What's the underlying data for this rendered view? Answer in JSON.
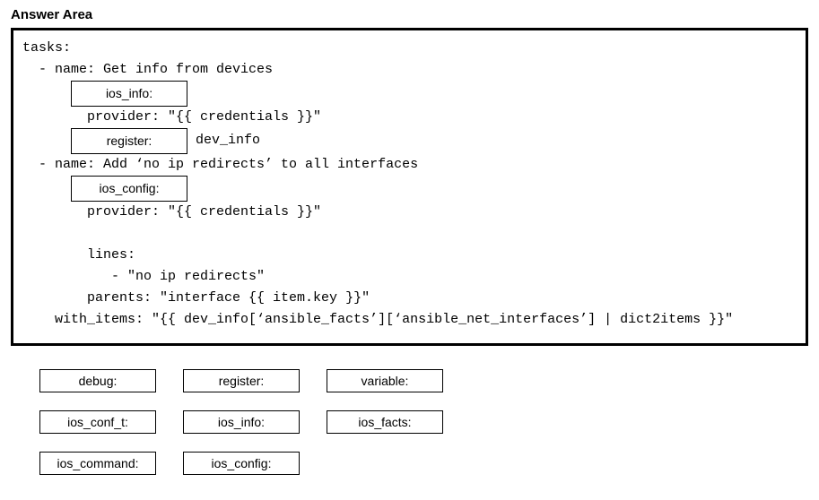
{
  "title": "Answer Area",
  "code": {
    "tasks_label": "tasks:",
    "task1_name": "  - name: Get info from devices",
    "slot1_value": "ios_info:",
    "provider1": "provider: \"{{ credentials }}\"",
    "slot2_value": "register:",
    "dev_info": " dev_info",
    "task2_name": "  - name: Add ‘no ip redirects’ to all interfaces",
    "slot3_value": "ios_config:",
    "provider2": "provider: \"{{ credentials }}\"",
    "lines_label": "lines:",
    "lines_item": "   - \"no ip redirects\"",
    "parents": "parents: \"interface {{ item.key }}\"",
    "with_items": "    with_items: \"{{ dev_info[‘ansible_facts’][‘ansible_net_interfaces’] | dict2items }}\""
  },
  "options": {
    "row1": [
      "debug:",
      "register:",
      "variable:"
    ],
    "row2": [
      "ios_conf_t:",
      "ios_info:",
      "ios_facts:"
    ],
    "row3": [
      "ios_command:",
      "ios_config:"
    ]
  }
}
